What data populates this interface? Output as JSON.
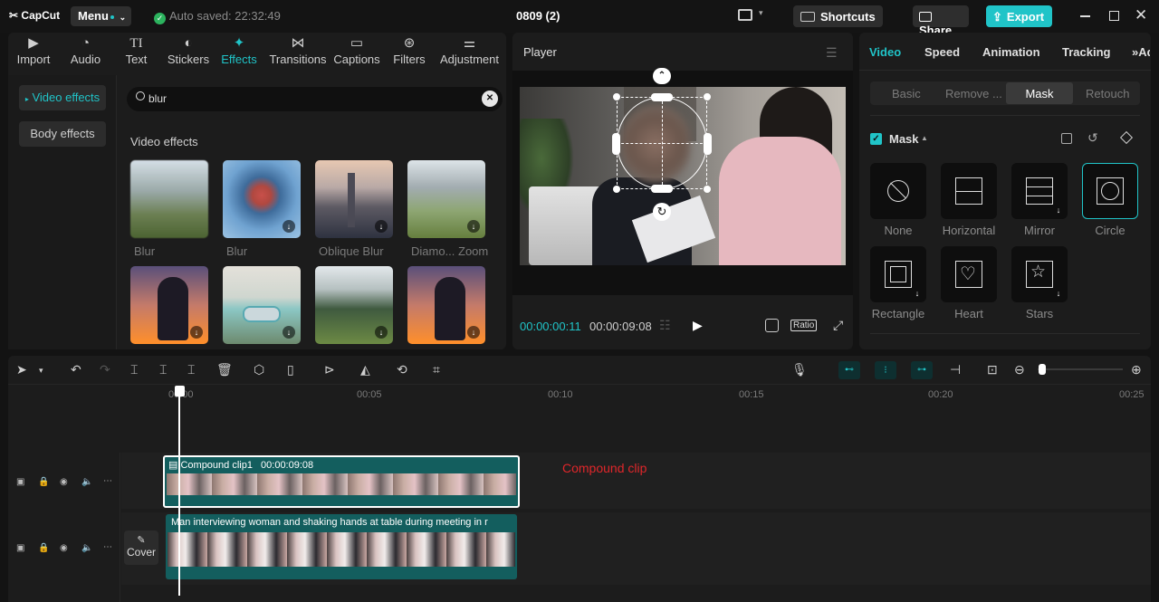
{
  "app": {
    "logo": "CapCut",
    "menu_label": "Menu",
    "autosave": "Auto saved: 22:32:49",
    "project_title": "0809 (2)"
  },
  "topbar": {
    "shortcuts": "Shortcuts",
    "share": "Share",
    "export": "Export"
  },
  "media_tabs": [
    "Import",
    "Audio",
    "Text",
    "Stickers",
    "Effects",
    "Transitions",
    "Captions",
    "Filters",
    "Adjustment"
  ],
  "sidebar": {
    "video_effects": "Video effects",
    "body_effects": "Body effects"
  },
  "search": {
    "value": "blur"
  },
  "effects": {
    "section_title": "Video effects",
    "items": [
      "Blur",
      "Blur",
      "Oblique Blur",
      "Diamo... Zoom"
    ]
  },
  "player": {
    "title": "Player",
    "current_time": "00:00:00:11",
    "total_time": "00:00:09:08",
    "ratio_label": "Ratio"
  },
  "inspector": {
    "tabs": [
      "Video",
      "Speed",
      "Animation",
      "Tracking",
      "Adj"
    ],
    "subtabs": [
      "Basic",
      "Remove ...",
      "Mask",
      "Retouch"
    ],
    "mask_title": "Mask",
    "masks": [
      "None",
      "Horizontal",
      "Mirror",
      "Circle",
      "Rectangle",
      "Heart",
      "Stars"
    ]
  },
  "timeline": {
    "ruler": [
      "00:00",
      "00:05",
      "00:10",
      "00:15",
      "00:20",
      "00:25"
    ],
    "compound_clip_name": "Compound clip1",
    "compound_clip_duration": "00:00:09:08",
    "annotation": "Compound clip",
    "main_clip_title": "Man interviewing woman and shaking hands at table during meeting in r",
    "cover_label": "Cover"
  },
  "colors": {
    "accent": "#20c4c8",
    "annotation": "#e0262a"
  }
}
